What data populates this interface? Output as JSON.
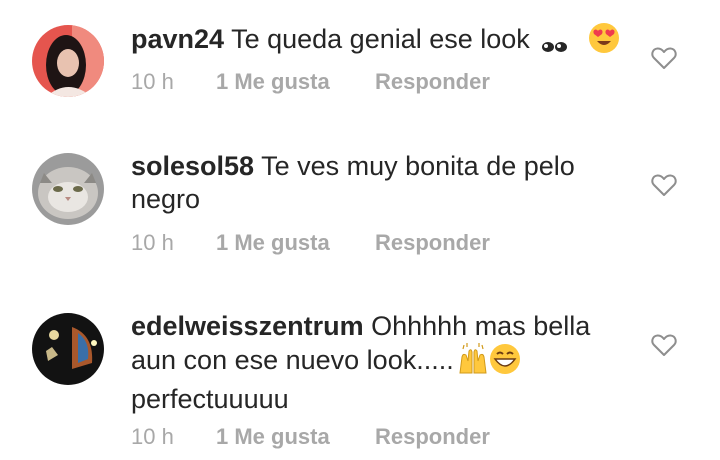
{
  "comments": [
    {
      "username": "pavn24",
      "text": "Te queda genial ese look",
      "emojis": [
        "eyes",
        "heart-eyes"
      ],
      "time": "10 h",
      "likes": "1 Me gusta",
      "reply": "Responder"
    },
    {
      "username": "solesol58",
      "text": "Te ves muy bonita de pelo negro",
      "emojis": [],
      "time": "10 h",
      "likes": "1 Me gusta",
      "reply": "Responder"
    },
    {
      "username": "edelweisszentrum",
      "text": "Ohhhhh mas bella aun con ese nuevo look.....",
      "text_after": "perfectuuuuu",
      "emojis": [
        "raising-hands",
        "grinning-face"
      ],
      "time": "10 h",
      "likes": "1 Me gusta",
      "reply": "Responder"
    }
  ],
  "icons": {
    "like": "heart-outline-icon"
  },
  "colors": {
    "text": "#262626",
    "meta": "#a8a8a8",
    "heart": "#8e8e8e"
  }
}
